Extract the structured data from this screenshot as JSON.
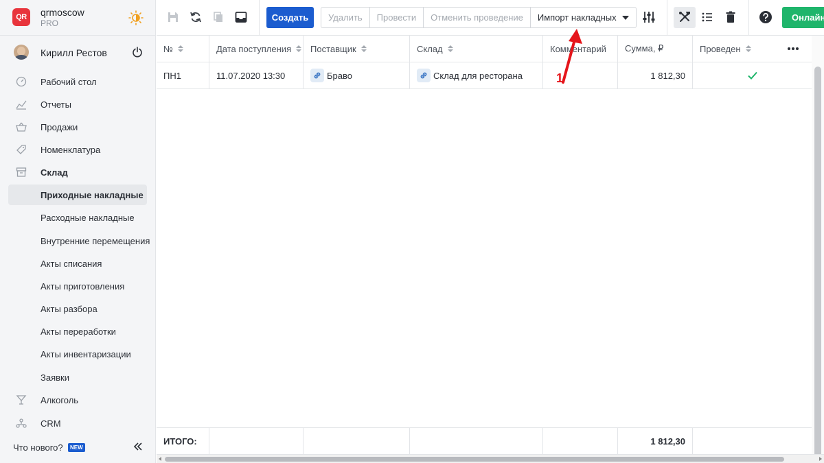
{
  "brand": {
    "name": "qrmoscow",
    "plan": "PRO",
    "logo_text": "QR"
  },
  "user": {
    "name": "Кирилл Рестов"
  },
  "nav": [
    {
      "label": "Рабочий стол",
      "icon": "dashboard-icon",
      "level": 0
    },
    {
      "label": "Отчеты",
      "icon": "reports-icon",
      "level": 0
    },
    {
      "label": "Продажи",
      "icon": "basket-icon",
      "level": 0
    },
    {
      "label": "Номенклатура",
      "icon": "tag-icon",
      "level": 0
    },
    {
      "label": "Склад",
      "icon": "warehouse-icon",
      "level": 0
    },
    {
      "label": "Приходные накладные",
      "level": 1
    },
    {
      "label": "Расходные накладные",
      "level": 1
    },
    {
      "label": "Внутренние перемещения",
      "level": 1
    },
    {
      "label": "Акты списания",
      "level": 1
    },
    {
      "label": "Акты приготовления",
      "level": 1
    },
    {
      "label": "Акты разбора",
      "level": 1
    },
    {
      "label": "Акты переработки",
      "level": 1
    },
    {
      "label": "Акты инвентаризации",
      "level": 1
    },
    {
      "label": "Заявки",
      "level": 1
    },
    {
      "label": "Алкоголь",
      "icon": "cocktail-icon",
      "level": 0
    },
    {
      "label": "CRM",
      "icon": "crm-icon",
      "level": 0
    }
  ],
  "footer_nav": {
    "whats_new": "Что нового?",
    "badge": "NEW"
  },
  "toolbar": {
    "create": "Создать",
    "delete": "Удалить",
    "post": "Провести",
    "unpost": "Отменить проведение",
    "import": "Импорт накладных",
    "online": "Онлайн"
  },
  "table": {
    "columns": [
      "№",
      "Дата поступления",
      "Поставщик",
      "Склад",
      "Комментарий",
      "Сумма, ₽",
      "Проведен"
    ],
    "rows": [
      {
        "number": "ПН1",
        "date": "11.07.2020 13:30",
        "supplier": "Браво",
        "warehouse": "Склад для ресторана",
        "comment": "",
        "sum": "1 812,30",
        "posted": true
      }
    ],
    "footer": {
      "label": "ИТОГО:",
      "sum": "1 812,30"
    }
  },
  "annotation": {
    "label": "1",
    "color": "#e5151b"
  },
  "colors": {
    "primary": "#1b5ccf",
    "success": "#1fb56b",
    "logo": "#e8343c"
  }
}
